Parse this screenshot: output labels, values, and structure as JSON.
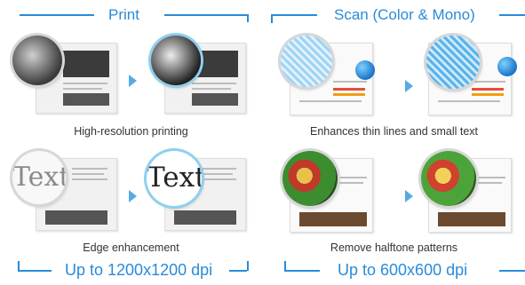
{
  "print": {
    "header": "Print",
    "footer": "Up to 1200x1200 dpi",
    "features": [
      {
        "caption": "High-resolution printing",
        "icon": "magnified-photo-icon"
      },
      {
        "caption": "Edge enhancement",
        "icon": "magnified-text-icon",
        "magnified_text": "Text"
      }
    ]
  },
  "scan": {
    "header": "Scan (Color & Mono)",
    "footer": "Up to 600x600 dpi",
    "features": [
      {
        "caption": "Enhances thin lines and small text",
        "icon": "magnified-globe-icon"
      },
      {
        "caption": "Remove halftone patterns",
        "icon": "magnified-food-icon"
      }
    ]
  },
  "colors": {
    "accent": "#2a8bd8",
    "arrow": "#58a9e6"
  }
}
